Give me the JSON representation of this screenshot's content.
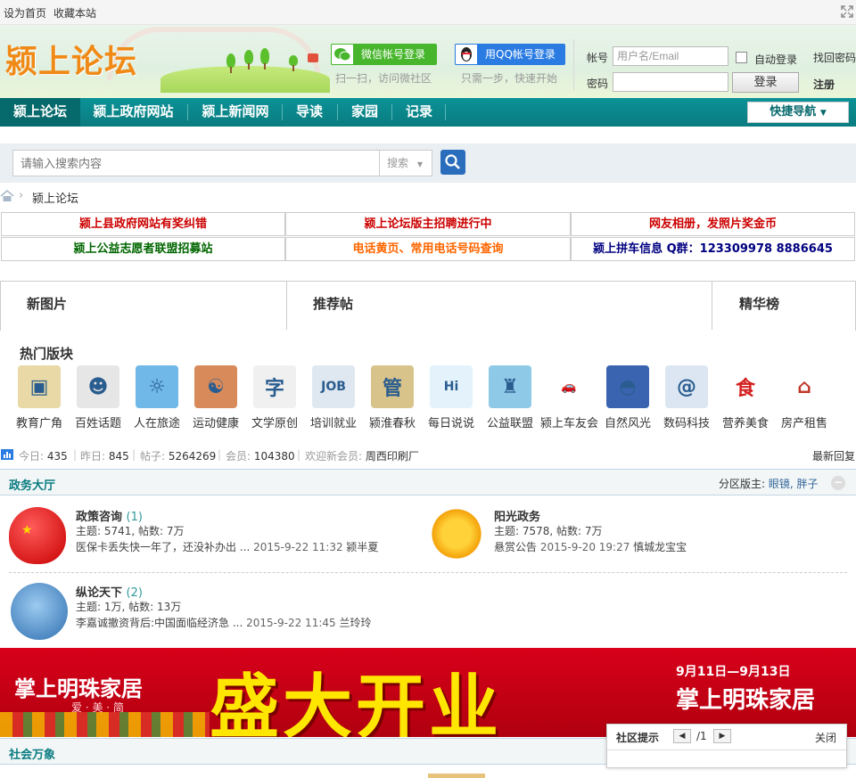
{
  "topbar": {
    "set_home": "设为首页",
    "bookmark": "收藏本站"
  },
  "header": {
    "logo_text": "颍上论坛",
    "wechat_login": "微信帐号登录",
    "wechat_hint": "扫一扫，访问微社区",
    "qq_login": "用QQ帐号登录",
    "qq_hint": "只需一步，快速开始",
    "account_label": "帐号",
    "account_placeholder": "用户名/Email",
    "password_label": "密码",
    "auto_login": "自动登录",
    "find_password": "找回密码",
    "login_button": "登录",
    "register": "注册"
  },
  "nav": {
    "items": [
      "颍上论坛",
      "颍上政府网站",
      "颍上新闻网",
      "导读",
      "家园",
      "记录"
    ],
    "quick_nav": "快捷导航"
  },
  "search": {
    "placeholder": "请输入搜索内容",
    "type": "搜索"
  },
  "breadcrumb": {
    "current": "颍上论坛"
  },
  "notices": [
    {
      "text": "颍上县政府网站有奖纠错",
      "color": "#cc0000"
    },
    {
      "text": "颍上论坛版主招聘进行中",
      "color": "#cc0000"
    },
    {
      "text": "网友相册，发照片奖金币",
      "color": "#cc0000"
    },
    {
      "text": "颍上公益志愿者联盟招募站",
      "color": "#006600"
    },
    {
      "text": "电话黄页、常用电话号码查询",
      "color": "#ff6600"
    },
    {
      "text": "颍上拼车信息  Q群：123309978 8886645",
      "color": "#000080"
    }
  ],
  "showcase": {
    "new_pics": "新图片",
    "recommended": "推荐帖",
    "ranking": "精华榜"
  },
  "hot": {
    "title": "热门版块",
    "items": [
      {
        "label": "教育广角",
        "icon": "photo-frame-icon",
        "bg": "#e8d9a6"
      },
      {
        "label": "百姓话题",
        "icon": "people-talking-icon",
        "bg": "#e6e6e6"
      },
      {
        "label": "人在旅途",
        "icon": "beach-icon",
        "bg": "#6fb8e8"
      },
      {
        "label": "运动健康",
        "icon": "yin-yang-icon",
        "bg": "#d88a5a"
      },
      {
        "label": "文学原创",
        "icon": "calligraphy-icon",
        "bg": "#f0f0f0"
      },
      {
        "label": "培训就业",
        "icon": "job-icon",
        "bg": "#dfe8f0"
      },
      {
        "label": "颍淮春秋",
        "icon": "scroll-icon",
        "bg": "#d8c38a"
      },
      {
        "label": "每日说说",
        "icon": "speech-bubble-icon",
        "bg": "#e3f2fb"
      },
      {
        "label": "公益联盟",
        "icon": "statue-icon",
        "bg": "#8ec9e8"
      },
      {
        "label": "颍上车友会",
        "icon": "car-icon",
        "bg": "#ffffff"
      },
      {
        "label": "自然风光",
        "icon": "sunset-icon",
        "bg": "#3a64b0"
      },
      {
        "label": "数码科技",
        "icon": "at-sign-icon",
        "bg": "#dbe6f2"
      },
      {
        "label": "营养美食",
        "icon": "food-icon",
        "bg": "#ffffff"
      },
      {
        "label": "房产租售",
        "icon": "house-icon",
        "bg": "#ffffff"
      }
    ]
  },
  "stats": {
    "today_label": "今日:",
    "today": "435",
    "yesterday_label": "昨日:",
    "yesterday": "845",
    "posts_label": "帖子:",
    "posts": "5264269",
    "members_label": "会员:",
    "members": "104380",
    "newest_label": "欢迎新会员:",
    "newest": "周西印刷厂",
    "latest_reply": "最新回复"
  },
  "section1": {
    "title": "政务大厅",
    "moderator_label": "分区版主:",
    "moderators": "眼镜, 胖子",
    "forums": [
      {
        "name": "政策咨询",
        "count": "(1)",
        "meta": "主题: 5741, 帖数: 7万",
        "last_title": "医保卡丢失快一年了，还没补办出 ...",
        "last_time": "2015-9-22 11:32",
        "last_user": "颍半夏",
        "icon": "heart-flag-icon"
      },
      {
        "name": "阳光政务",
        "count": "",
        "meta": "主题: 7578, 帖数: 7万",
        "last_title": "悬赏公告",
        "last_time": "2015-9-20 19:27",
        "last_user": "慎城龙宝宝",
        "icon": "sun-icon"
      },
      {
        "name": "纵论天下",
        "count": "(2)",
        "meta": "主题: 1万, 帖数: 13万",
        "last_title": "李嘉诚撤资背后:中国面临经济急 ...",
        "last_time": "2015-9-22 11:45",
        "last_user": "兰玲玲",
        "icon": "globe-headset-icon"
      }
    ]
  },
  "banner": {
    "brand": "掌上明珠家居",
    "slogan": "爱 · 美 · 简",
    "headline": "盛大开业",
    "dates": "9月11日—9月13日",
    "brand_right": "掌上明珠家居"
  },
  "section2": {
    "title": "社会万象"
  },
  "tip": {
    "title": "社区提示",
    "page": "/1",
    "close": "关闭"
  },
  "colors": {
    "nav_teal": "#0a8488",
    "link_blue": "#336699",
    "orange": "#f08a17",
    "red": "#cc0000"
  }
}
